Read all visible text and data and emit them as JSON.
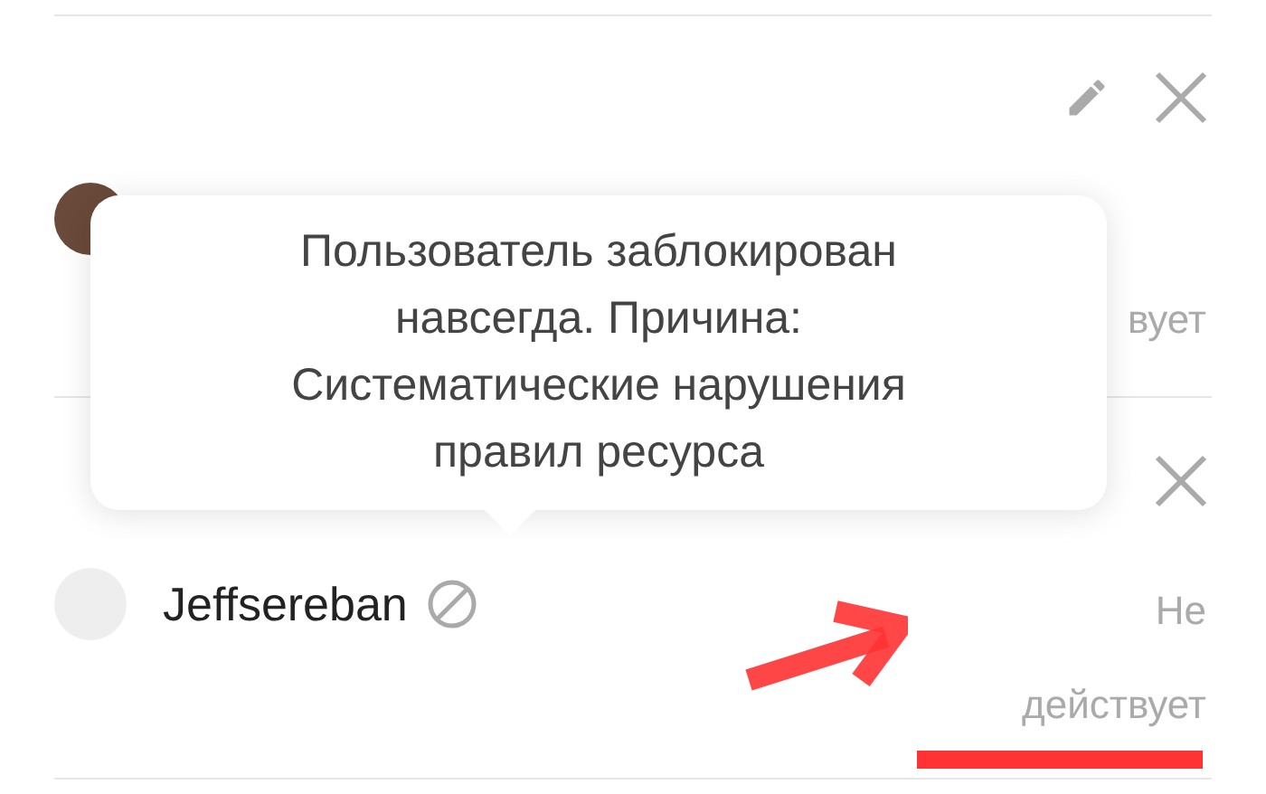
{
  "users": [
    {
      "kind": "covered",
      "status": [
        "вует"
      ],
      "editable": true,
      "removable": true
    },
    {
      "kind": "normal",
      "name": "Jeffsereban",
      "status": [
        "Не",
        "действует"
      ],
      "removable": true,
      "banned": true
    }
  ],
  "tooltip": {
    "text": "Пользователь заблокирован навсегда. Причина: Систематические нарушения правил ресурса"
  }
}
